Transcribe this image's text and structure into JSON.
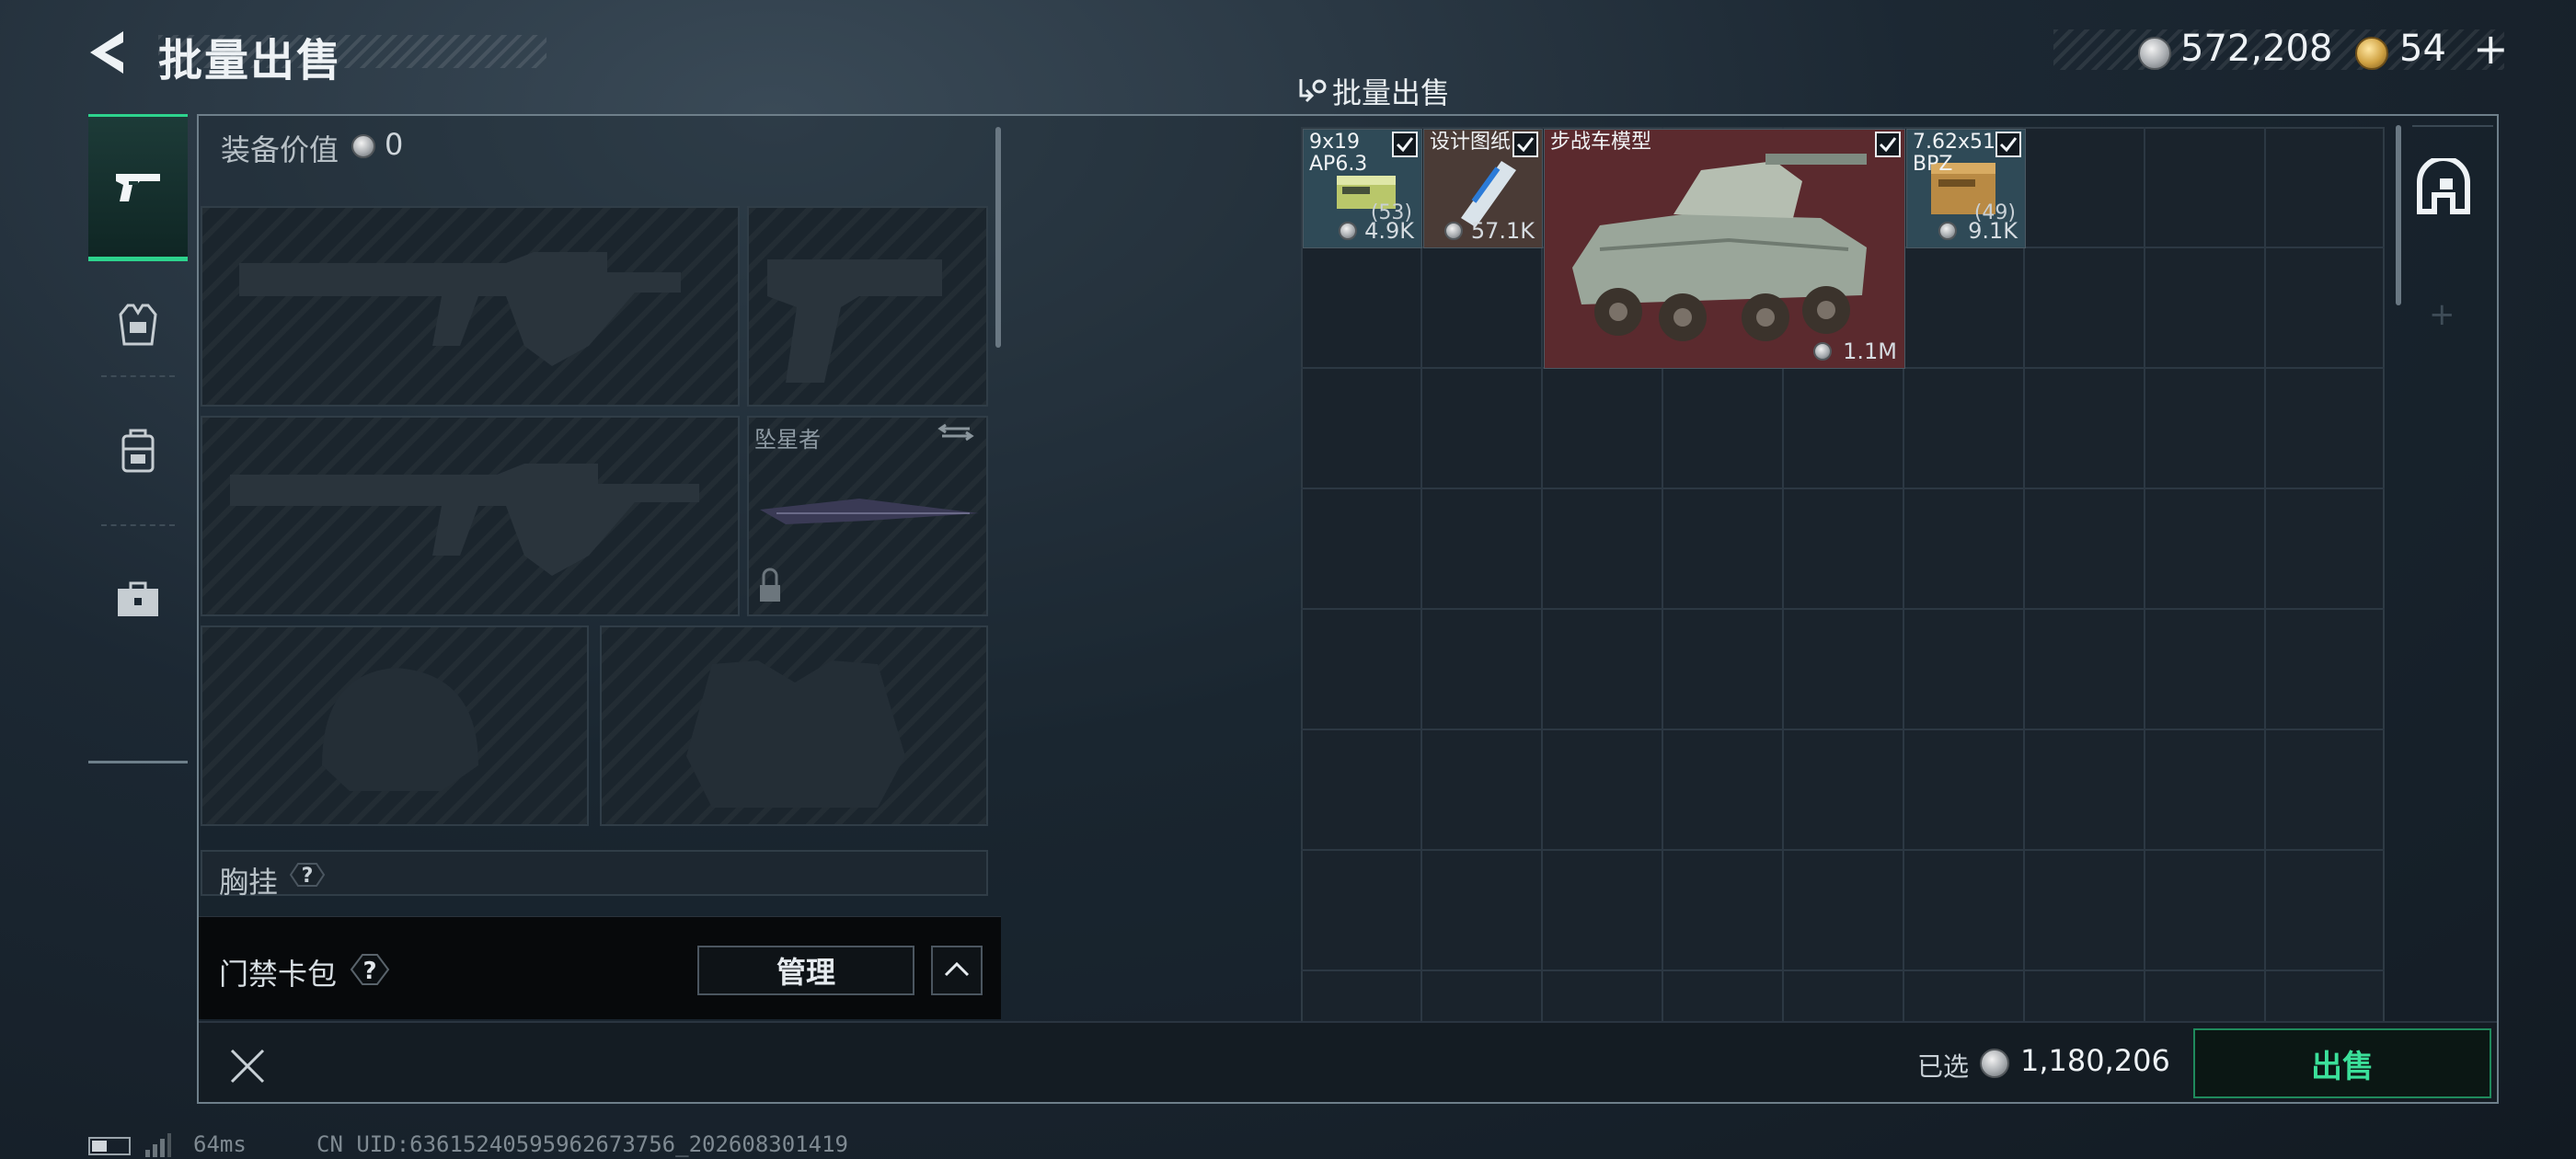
{
  "header": {
    "title": "批量出售",
    "section_title": "批量出售",
    "currency_silver": "572,208",
    "currency_gold": "54",
    "currency_plus": "+"
  },
  "equipment": {
    "value_label": "装备价值",
    "value": "0",
    "melee_slot_label": "坠星者",
    "chest_rig_label": "胸挂",
    "help_mark": "?",
    "keycard_label": "门禁卡包",
    "manage_label": "管理"
  },
  "grid_items": [
    {
      "name": "9x19\nAP6.3",
      "qty": "(53)",
      "price": "4.9K",
      "checked": true
    },
    {
      "name": "设计图纸",
      "qty": "",
      "price": "57.1K",
      "checked": true
    },
    {
      "name": "步战车模型",
      "qty": "",
      "price": "1.1M",
      "checked": true
    },
    {
      "name": "7.62x51\nBPZ",
      "qty": "(49)",
      "price": "9.1K",
      "checked": true
    }
  ],
  "footer": {
    "selected_label": "已选",
    "selected_value": "1,180,206",
    "sell_label": "出售"
  },
  "status": {
    "ping": "64ms",
    "uid": "CN UID:6361524059596267375​6_202608301419"
  },
  "colors": {
    "accent_green": "#2dd38d",
    "vehicle_cell_bg": "#5b2a2e",
    "ammo_cell_bg": "#2f4a57"
  }
}
